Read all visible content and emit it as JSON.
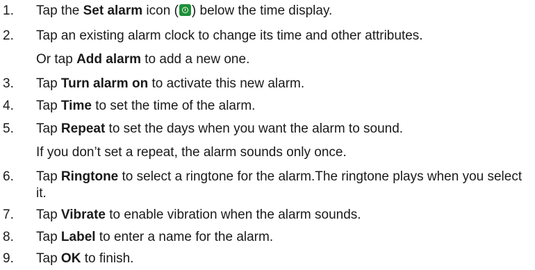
{
  "steps": [
    {
      "num": "1.",
      "parts": [
        {
          "t": "Tap the "
        },
        {
          "b": "Set alarm"
        },
        {
          "t": " icon ("
        },
        {
          "icon": "alarm-clock-icon"
        },
        {
          "t": ") below the time display."
        }
      ]
    },
    {
      "num": "2.",
      "parts": [
        {
          "t": "Tap an existing alarm clock to change its time and other attributes."
        }
      ],
      "note": [
        {
          "t": "Or tap "
        },
        {
          "b": "Add alarm"
        },
        {
          "t": " to add a new one."
        }
      ]
    },
    {
      "num": "3.",
      "parts": [
        {
          "t": "Tap "
        },
        {
          "b": "Turn alarm on"
        },
        {
          "t": " to activate this new alarm."
        }
      ]
    },
    {
      "num": "4.",
      "parts": [
        {
          "t": "Tap "
        },
        {
          "b": "Time"
        },
        {
          "t": " to set the time of the alarm."
        }
      ]
    },
    {
      "num": "5.",
      "parts": [
        {
          "t": "Tap "
        },
        {
          "b": "Repeat"
        },
        {
          "t": " to set the days when you want the alarm to sound."
        }
      ],
      "note": [
        {
          "t": "If you don’t set a repeat, the alarm sounds only once."
        }
      ]
    },
    {
      "num": "6.",
      "parts": [
        {
          "t": "Tap "
        },
        {
          "b": "Ringtone"
        },
        {
          "t": " to select a ringtone for the alarm.The ringtone plays when you select it."
        }
      ]
    },
    {
      "num": "7.",
      "parts": [
        {
          "t": "Tap "
        },
        {
          "b": "Vibrate"
        },
        {
          "t": " to enable vibration when the alarm sounds."
        }
      ]
    },
    {
      "num": "8.",
      "parts": [
        {
          "t": "Tap "
        },
        {
          "b": "Label"
        },
        {
          "t": " to enter a name for the alarm."
        }
      ]
    },
    {
      "num": "9.",
      "parts": [
        {
          "t": "Tap "
        },
        {
          "b": "OK"
        },
        {
          "t": " to finish."
        }
      ]
    }
  ],
  "colors": {
    "text": "#1a1a1a",
    "icon_bg": "#1f8f3a"
  }
}
